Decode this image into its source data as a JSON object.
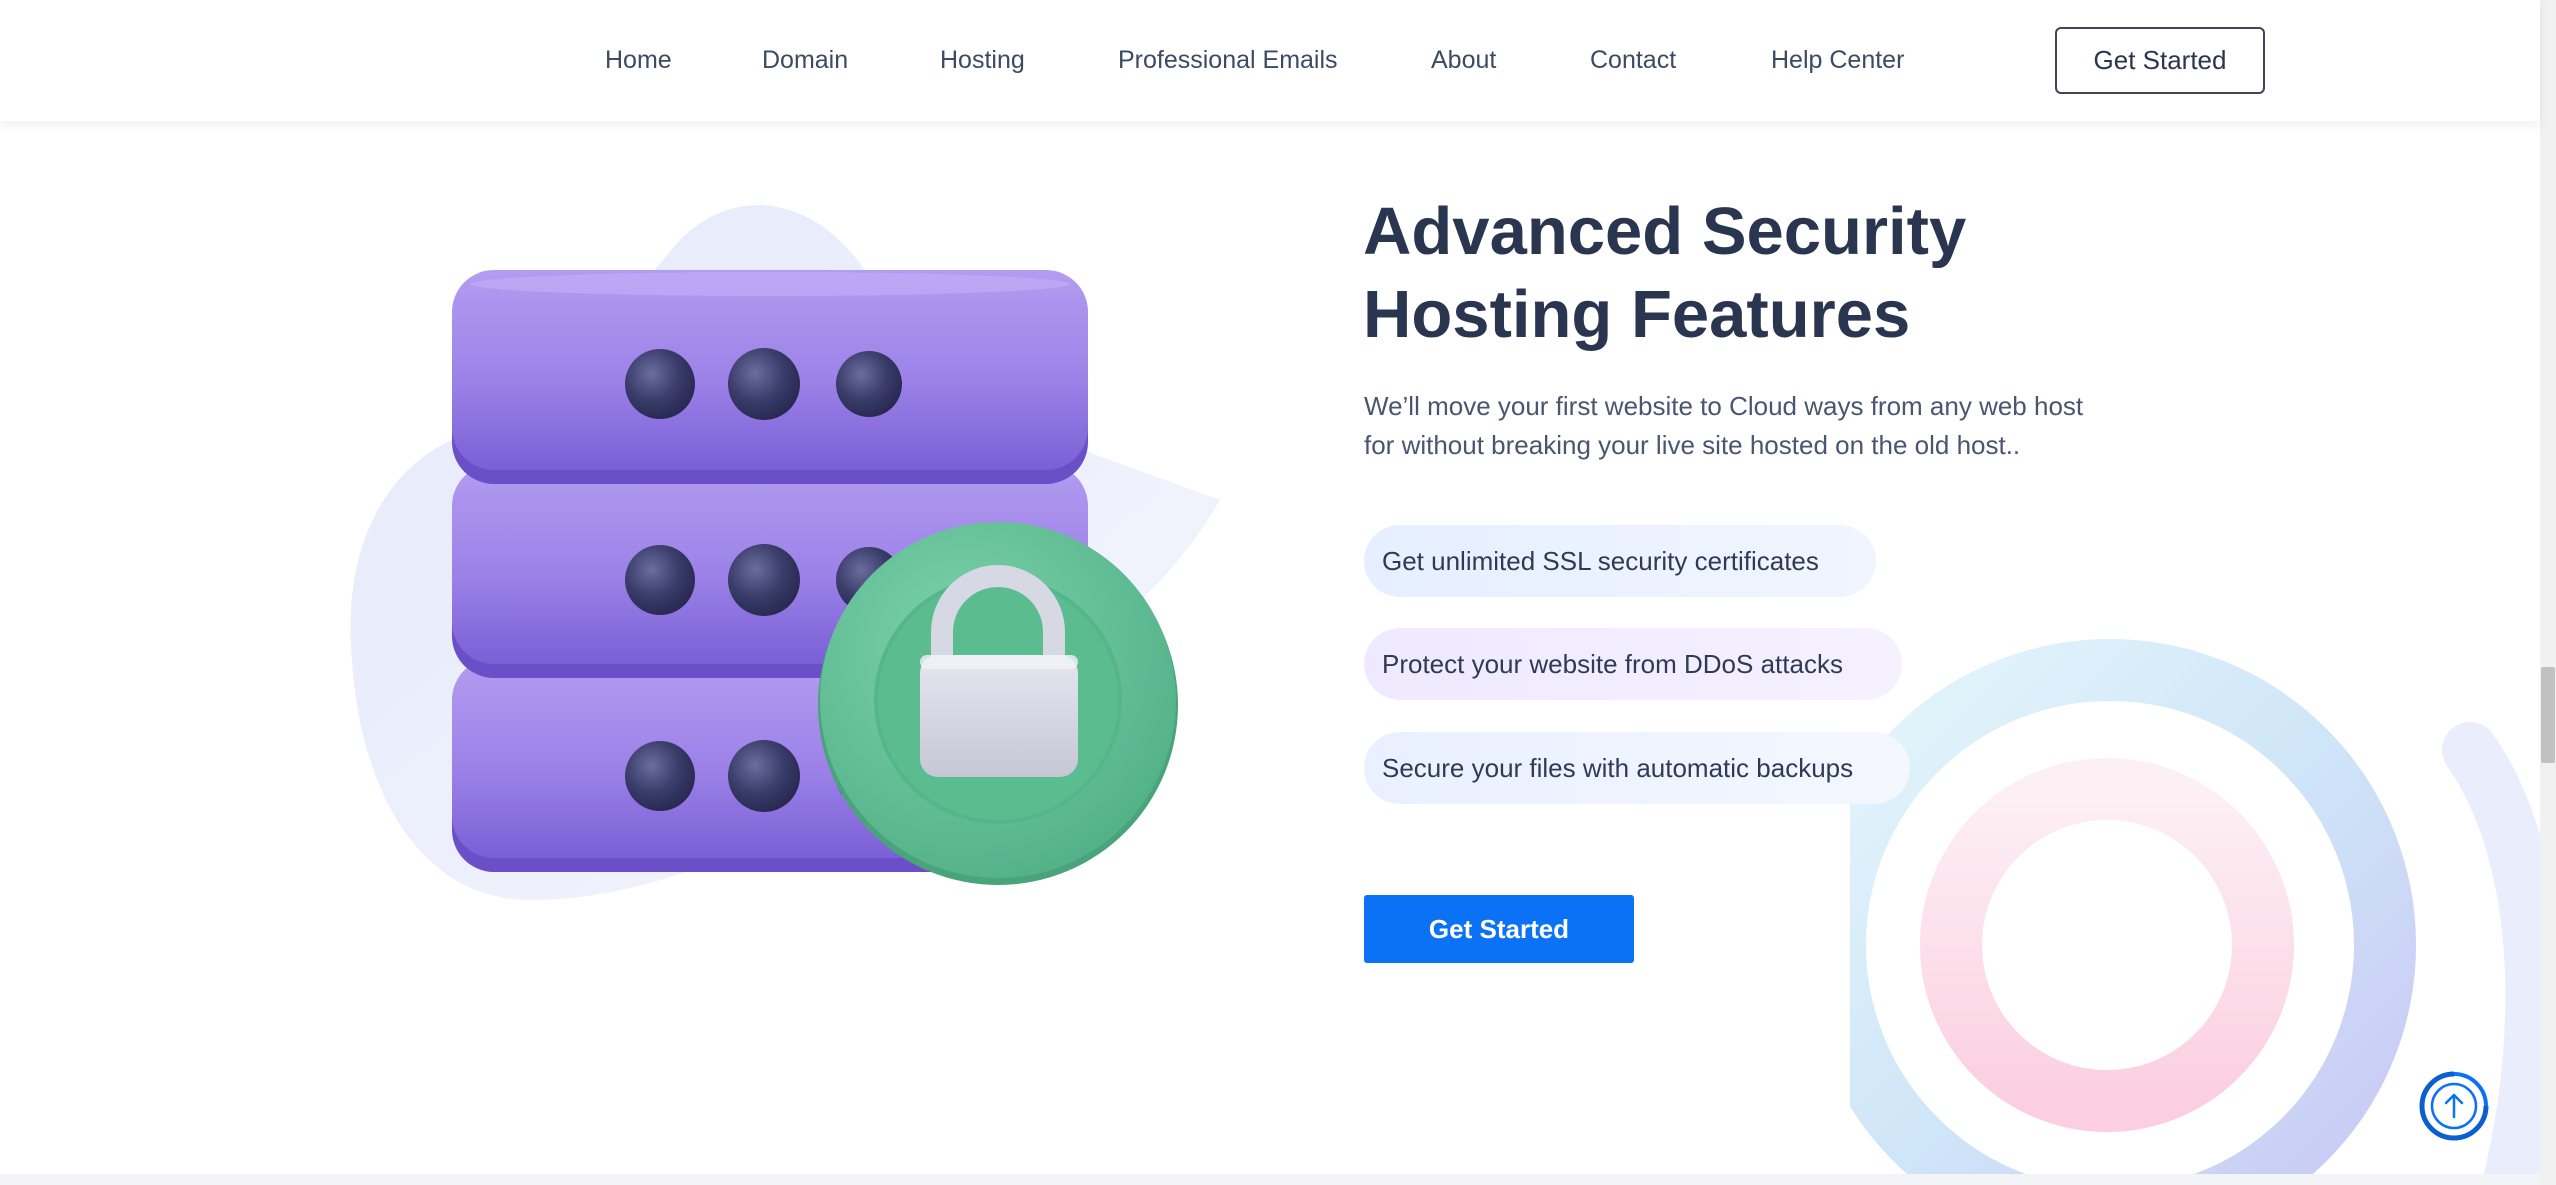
{
  "nav": {
    "items": [
      {
        "label": "Home"
      },
      {
        "label": "Domain"
      },
      {
        "label": "Hosting"
      },
      {
        "label": "Professional Emails"
      },
      {
        "label": "About"
      },
      {
        "label": "Contact"
      },
      {
        "label": "Help Center"
      }
    ],
    "cta_label": "Get Started"
  },
  "hero": {
    "title_lines": [
      "Advanced Security",
      "Hosting Features"
    ],
    "description_lines": [
      "We’ll move your first website to Cloud ways from any web host",
      "for without breaking your live site hosted on the old host.."
    ],
    "features": [
      {
        "label": "Get unlimited SSL security certificates"
      },
      {
        "label": "Protect your website from DDoS attacks"
      },
      {
        "label": "Secure your files with automatic backups"
      }
    ],
    "cta_label": "Get Started",
    "illustration_icon": "server-lock-icon"
  },
  "colors": {
    "accent": "#0b72f5",
    "heading": "#2a3550",
    "server_purple": "#9b7fe6",
    "lock_badge_green": "#5fc096"
  },
  "back_to_top_icon": "arrow-up-icon"
}
